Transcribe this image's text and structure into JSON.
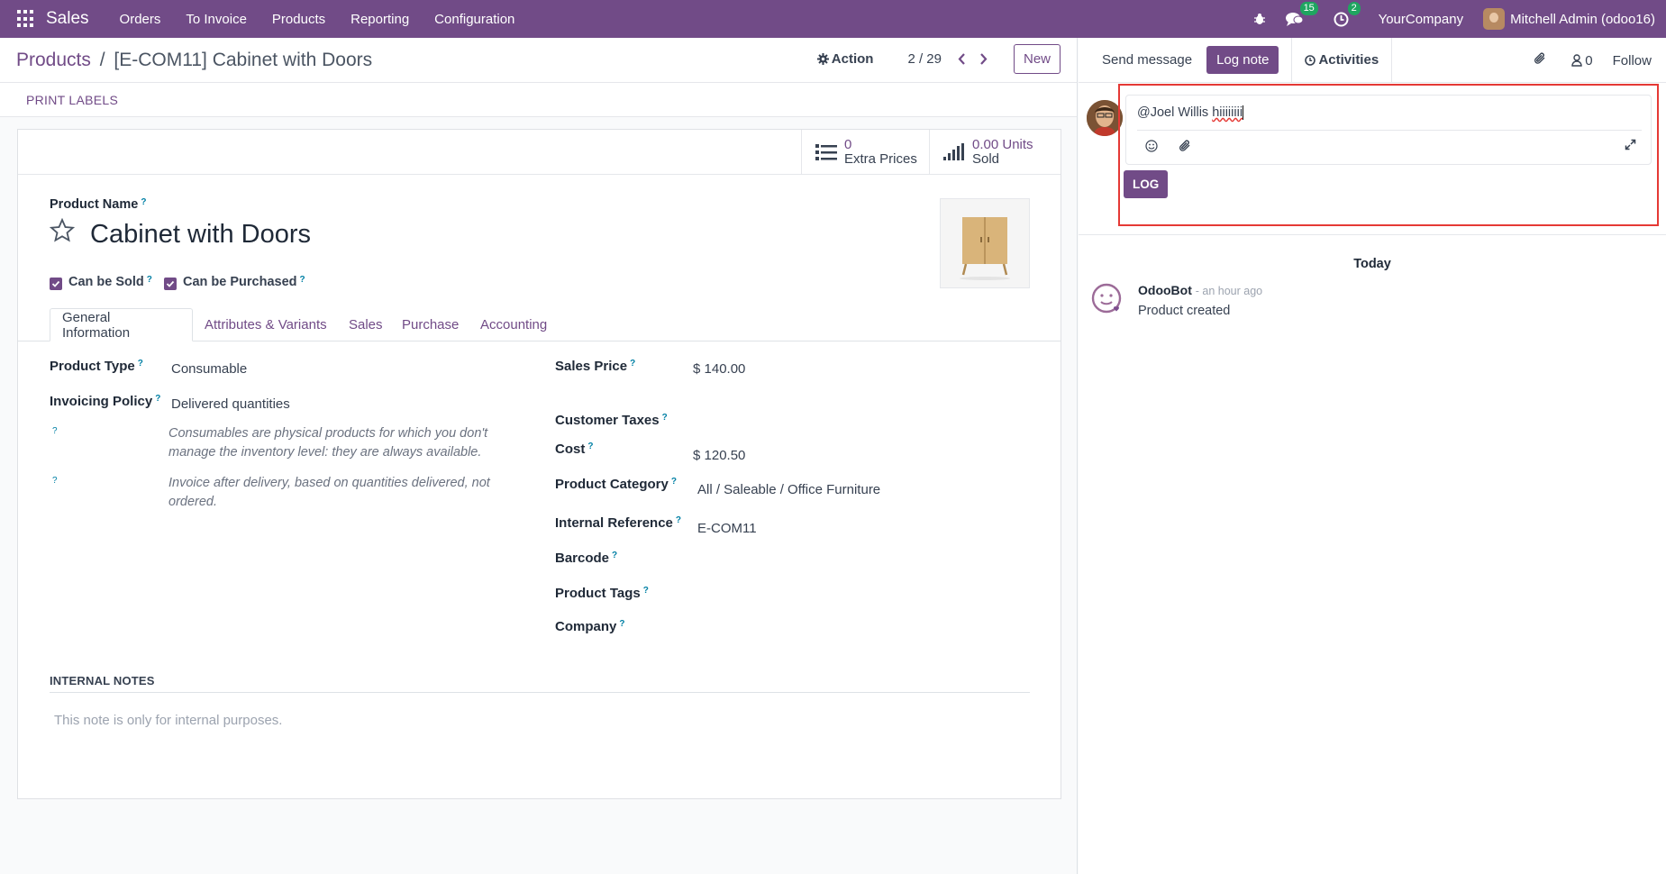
{
  "topbar": {
    "app": "Sales",
    "menu": [
      "Orders",
      "To Invoice",
      "Products",
      "Reporting",
      "Configuration"
    ],
    "messages_count": "15",
    "activities_count": "2",
    "company": "YourCompany",
    "user": "Mitchell Admin (odoo16)"
  },
  "control": {
    "breadcrumb_root": "Products",
    "breadcrumb_sep": "/",
    "record": "[E-COM11] Cabinet with Doors",
    "action": "Action",
    "pager": "2 / 29",
    "new": "New"
  },
  "status": {
    "print_labels": "PRINT LABELS"
  },
  "smart_buttons": {
    "extra_prices_value": "0",
    "extra_prices_label": "Extra Prices",
    "units_value": "0.00 Units",
    "units_label": "Sold"
  },
  "form": {
    "product_name_label": "Product Name",
    "product_name": "Cabinet with Doors",
    "can_be_sold": "Can be Sold",
    "can_be_purchased": "Can be Purchased",
    "tabs": [
      "General Information",
      "Attributes & Variants",
      "Sales",
      "Purchase",
      "Accounting"
    ],
    "product_type_label": "Product Type",
    "product_type": "Consumable",
    "invoicing_policy_label": "Invoicing Policy",
    "invoicing_policy": "Delivered quantities",
    "hint1_line1": "Consumables are physical products for which you don't",
    "hint1_line2": "manage the inventory level: they are always available.",
    "hint2_line1": "Invoice after delivery, based on quantities delivered, not",
    "hint2_line2": "ordered.",
    "sales_price_label": "Sales Price",
    "sales_price": "$ 140.00",
    "customer_taxes_label": "Customer Taxes",
    "cost_label": "Cost",
    "cost": "$ 120.50",
    "category_label": "Product Category",
    "category": "All / Saleable / Office Furniture",
    "internal_ref_label": "Internal Reference",
    "internal_ref": "E-COM11",
    "barcode_label": "Barcode",
    "tags_label": "Product Tags",
    "company_label": "Company",
    "internal_notes_label": "INTERNAL NOTES",
    "internal_notes_placeholder": "This note is only for internal purposes.",
    "help_marker": "?"
  },
  "chatter": {
    "send_message": "Send message",
    "log_note": "Log note",
    "activities": "Activities",
    "followers_count": "0",
    "follow": "Follow",
    "composer_mention": "@Joel Willis ",
    "composer_text": "hiiiiiiii",
    "log_button": "LOG",
    "date_separator": "Today",
    "msg_author": "OdooBot",
    "msg_time": "- an hour ago",
    "msg_body": "Product created"
  },
  "colors": {
    "brand": "#714b87",
    "badge": "#1fa560",
    "highlight": "#e53935"
  }
}
